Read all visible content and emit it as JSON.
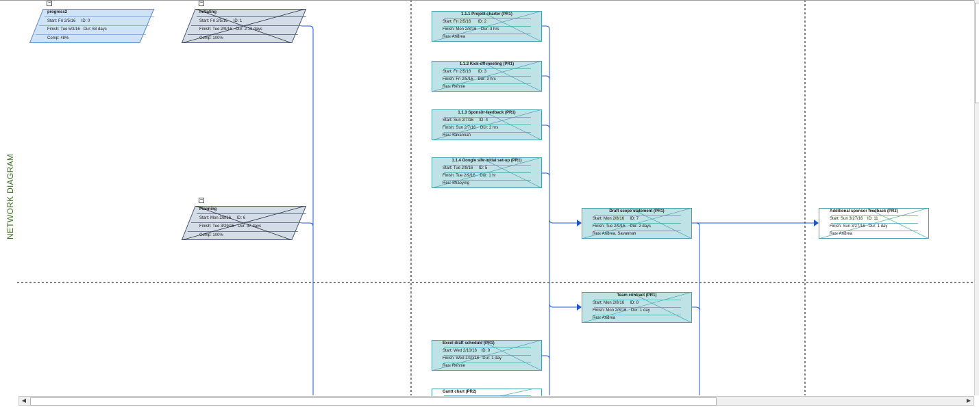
{
  "view": {
    "vertical_label": "NETWORK DIAGRAM"
  },
  "summary_nodes": [
    {
      "id": "progress2",
      "title": "progress2",
      "start": "Start:  Fri 2/5/16",
      "id_text": "ID:   0",
      "finish": "Finish: Tue 5/3/16",
      "dur": "Dur: 63 days",
      "comp": "Comp: 48%"
    },
    {
      "id": "initiating",
      "title": "Initiating",
      "start": "Start:  Fri 2/5/16",
      "id_text": "ID:   1",
      "finish": "Finish: Tue 2/9/16",
      "dur": "Dur: 2.13 days",
      "comp": "Comp: 100%"
    },
    {
      "id": "planning",
      "title": "Planning",
      "start": "Start:  Mon 2/8/16",
      "id_text": "ID:   6",
      "finish": "Finish: Tue 3/29/16",
      "dur": "Dur: 37 days",
      "comp": "Comp: 100%"
    }
  ],
  "task_nodes": [
    {
      "id": "charter",
      "title": "1.1.1 Project charter (PR1)",
      "start": "Start:  Fri 2/5/16",
      "id_text": "ID:   2",
      "finish": "Finish: Mon 2/8/16",
      "dur": "Dur: 3 hrs",
      "res": "Res:      Andrea"
    },
    {
      "id": "kickoff",
      "title": "1.1.2 Kick-off meeting (PR1)",
      "start": "Start:  Fri 2/5/16",
      "id_text": "ID:   3",
      "finish": "Finish: Fri 2/5/16",
      "dur": "Dur: 3 hrs",
      "res": "Res:      Rennie"
    },
    {
      "id": "sponsor",
      "title": "1.1.3 Sponsor feedback (PR1)",
      "start": "Start:  Sun 2/7/16",
      "id_text": "ID:   4",
      "finish": "Finish: Sun 2/7/16",
      "dur": "Dur: 2 hrs",
      "res": "Res:      Savannah"
    },
    {
      "id": "google",
      "title": "1.1.4 Google site initial set-up (PR1)",
      "start": "Start:  Tue 2/9/16",
      "id_text": "ID:   5",
      "finish": "Finish: Tue 2/9/16",
      "dur": "Dur: 1 hr",
      "res": "Res:      Shaoying"
    },
    {
      "id": "scope",
      "title": "Draft scope statement (PR1)",
      "start": "Start:  Mon 2/8/16",
      "id_text": "ID:   7",
      "finish": "Finish: Tue 2/9/16",
      "dur": "Dur: 2 days",
      "res": "Res:      Andrea, Savannah"
    },
    {
      "id": "team",
      "title": "Team contract (PR1)",
      "start": "Start:  Mon 2/8/16",
      "id_text": "ID:   8",
      "finish": "Finish: Mon 2/8/16",
      "dur": "Dur: 1 day",
      "res": "Res:      Andrea"
    },
    {
      "id": "excel",
      "title": "Excel draft schedule (PR1)",
      "start": "Start:  Wed 2/10/16",
      "id_text": "ID:   9",
      "finish": "Finish: Wed 2/10/16",
      "dur": "Dur: 1 day",
      "res": "Res:      Rennie"
    },
    {
      "id": "gantt",
      "title": "Gantt chart (PR2)"
    },
    {
      "id": "addsponsor",
      "title": "Additional sponsor feedback (PR2)",
      "start": "Start:  Sun 3/27/16",
      "id_text": "ID:   11",
      "finish": "Finish: Sun 3/27/16",
      "dur": "Dur: 1 day",
      "res": "Res:      Andrea"
    }
  ],
  "colors": {
    "summary_active_fill": "#cfe3f7",
    "summary_fill": "#d4dce7",
    "task_fill": "#bfe2e6",
    "task_border": "#4aa2ad",
    "link_line": "#1f55c8",
    "label_green": "#3b6a23"
  },
  "icons": {
    "collapse": "−",
    "scroll_left": "◀",
    "scroll_right": "▶"
  }
}
